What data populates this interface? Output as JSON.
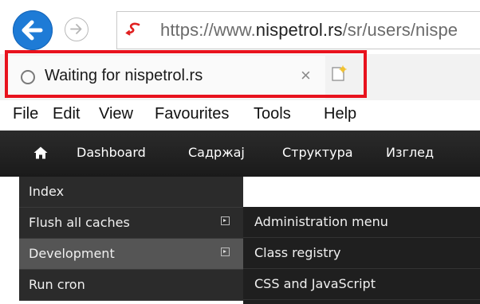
{
  "browser": {
    "url_prefix": "https://www.",
    "url_domain": "nispetrol.rs",
    "url_suffix": "/sr/users/nispe",
    "tab_title": "Waiting for nispetrol.rs",
    "tab_close": "×",
    "icons": {
      "back": "back-arrow-icon",
      "forward": "forward-arrow-icon",
      "site": "site-logo-icon",
      "loading": "loading-spinner-icon",
      "new_tab": "new-tab-icon"
    },
    "highlight_color": "#e8121d",
    "accent_color": "#1e7bd6"
  },
  "menu": {
    "file": "File",
    "edit": "Edit",
    "view": "View",
    "favourites": "Favourites",
    "tools": "Tools",
    "help": "Help"
  },
  "toolbar": {
    "home_icon": "home-icon",
    "items": [
      "Dashboard",
      "Садржај",
      "Структура",
      "Изглед"
    ]
  },
  "dropdown": {
    "items": [
      {
        "label": "Index"
      },
      {
        "label": "Flush all caches"
      },
      {
        "label": "Development"
      },
      {
        "label": "Run cron"
      }
    ],
    "active_item": "Development"
  },
  "submenu": {
    "items": [
      "Administration menu",
      "Class registry",
      "CSS and JavaScript"
    ]
  }
}
